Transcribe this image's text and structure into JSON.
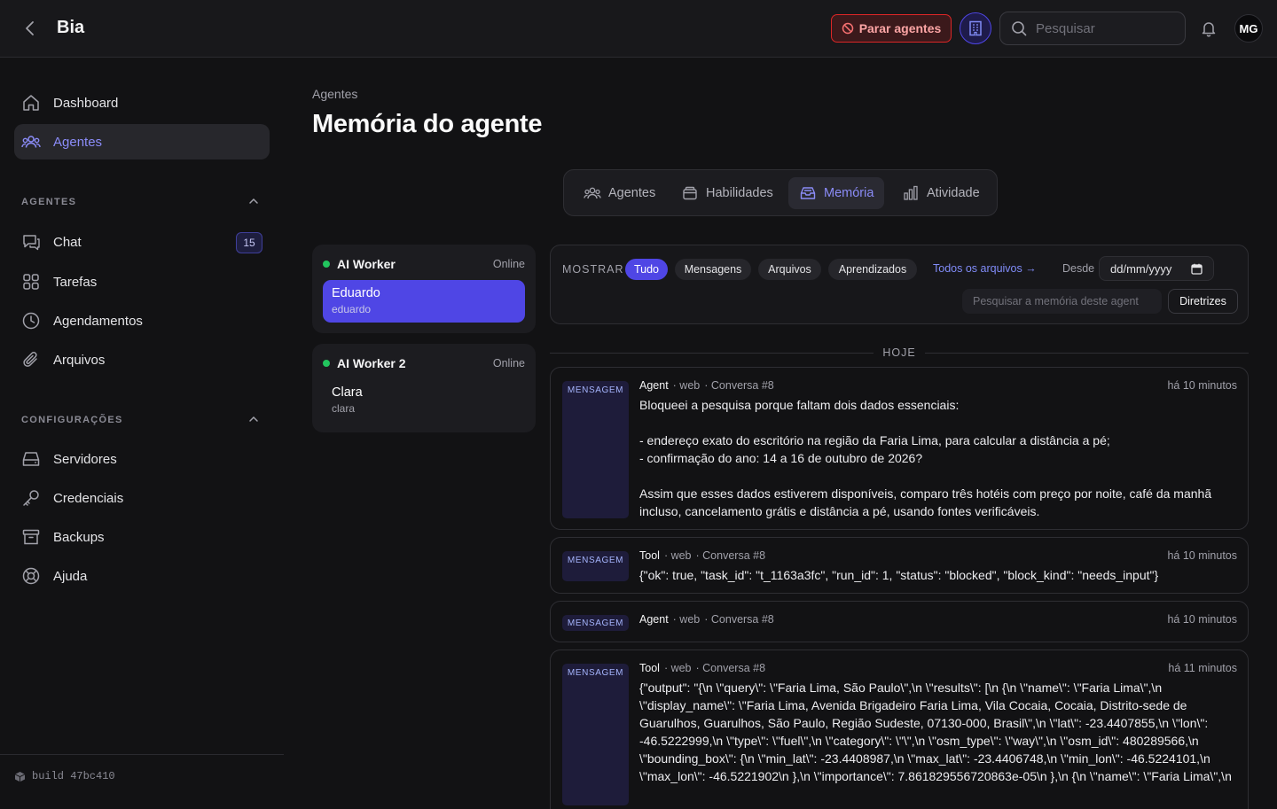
{
  "header": {
    "title": "Bia",
    "stop_agents_label": "Parar agentes",
    "search_placeholder": "Pesquisar",
    "avatar_initials": "MG"
  },
  "sidebar": {
    "items": [
      {
        "label": "Dashboard",
        "icon": "home-icon"
      },
      {
        "label": "Agentes",
        "icon": "users-icon",
        "active": true
      }
    ],
    "agentes_section": {
      "title": "AGENTES",
      "items": [
        {
          "label": "Chat",
          "icon": "chat-icon",
          "badge": "15"
        },
        {
          "label": "Tarefas",
          "icon": "grid-icon"
        },
        {
          "label": "Agendamentos",
          "icon": "clock-icon"
        },
        {
          "label": "Arquivos",
          "icon": "paperclip-icon"
        }
      ]
    },
    "config_section": {
      "title": "CONFIGURAÇÕES",
      "items": [
        {
          "label": "Servidores",
          "icon": "server-icon"
        },
        {
          "label": "Credenciais",
          "icon": "key-icon"
        },
        {
          "label": "Backups",
          "icon": "archive-icon"
        },
        {
          "label": "Ajuda",
          "icon": "lifebuoy-icon"
        }
      ]
    },
    "footer": "build 47bc410"
  },
  "main": {
    "breadcrumb": "Agentes",
    "title": "Memória do agente",
    "tabs": [
      {
        "label": "Agentes"
      },
      {
        "label": "Habilidades"
      },
      {
        "label": "Memória",
        "active": true
      },
      {
        "label": "Atividade"
      }
    ],
    "agents": [
      {
        "name": "AI Worker",
        "status": "Online",
        "user_name": "Eduardo",
        "user_handle": "eduardo",
        "selected": true
      },
      {
        "name": "AI Worker 2",
        "status": "Online",
        "user_name": "Clara",
        "user_handle": "clara",
        "selected": false
      }
    ],
    "filters": {
      "show_label": "MOSTRAR",
      "chips": [
        "Tudo",
        "Mensagens",
        "Arquivos",
        "Aprendizados"
      ],
      "active_chip": "Tudo",
      "all_files_link": "Todos os arquivos →",
      "since_label": "Desde",
      "date_placeholder": "dd/mm/yyyy",
      "search_placeholder": "Pesquisar a memória deste agent",
      "guidelines_button": "Diretrizes"
    },
    "day_label": "HOJE",
    "memories": [
      {
        "tag": "MENSAGEM",
        "author": "Agent",
        "channel": "· web",
        "conversation": "· Conversa #8",
        "time": "há 10 minutos",
        "body": "Bloqueei a pesquisa porque faltam dois dados essenciais:\n\n- endereço exato do escritório na região da Faria Lima, para calcular a distância a pé;\n- confirmação do ano: 14 a 16 de outubro de 2026?\n\nAssim que esses dados estiverem disponíveis, comparo três hotéis com preço por noite, café da manhã incluso, cancelamento grátis e distância a pé, usando fontes verificáveis."
      },
      {
        "tag": "MENSAGEM",
        "author": "Tool",
        "channel": "· web",
        "conversation": "· Conversa #8",
        "time": "há 10 minutos",
        "body": "{\"ok\": true, \"task_id\": \"t_1163a3fc\", \"run_id\": 1, \"status\": \"blocked\", \"block_kind\": \"needs_input\"}"
      },
      {
        "tag": "MENSAGEM",
        "author": "Agent",
        "channel": "· web",
        "conversation": "· Conversa #8",
        "time": "há 10 minutos",
        "body": ""
      },
      {
        "tag": "MENSAGEM",
        "author": "Tool",
        "channel": "· web",
        "conversation": "· Conversa #8",
        "time": "há 11 minutos",
        "body": "{\"output\": \"{\\n  \\\"query\\\": \\\"Faria Lima, São Paulo\\\",\\n  \\\"results\\\": [\\n    {\\n      \\\"name\\\": \\\"Faria Lima\\\",\\n      \\\"display_name\\\": \\\"Faria Lima, Avenida Brigadeiro Faria Lima, Vila Cocaia, Cocaia, Distrito-sede de Guarulhos, Guarulhos, São Paulo, Região Sudeste, 07130-000, Brasil\\\",\\n      \\\"lat\\\": -23.4407855,\\n      \\\"lon\\\": -46.5222999,\\n      \\\"type\\\": \\\"fuel\\\",\\n      \\\"category\\\": \\\"\\\",\\n      \\\"osm_type\\\": \\\"way\\\",\\n      \\\"osm_id\\\": 480289566,\\n      \\\"bounding_box\\\": {\\n        \\\"min_lat\\\": -23.4408987,\\n        \\\"max_lat\\\": -23.4406748,\\n        \\\"min_lon\\\": -46.5224101,\\n        \\\"max_lon\\\": -46.5221902\\n      },\\n      \\\"importance\\\": 7.861829556720863e-05\\n    },\\n    {\\n      \\\"name\\\": \\\"Faria Lima\\\",\\n"
      }
    ]
  }
}
